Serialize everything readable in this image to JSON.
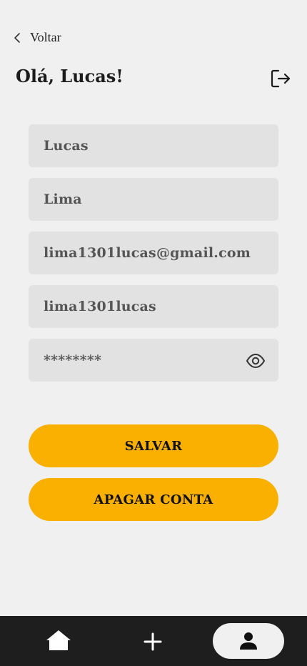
{
  "header": {
    "back_label": "Voltar",
    "greeting": "Olá, Lucas!"
  },
  "form": {
    "first_name": "Lucas",
    "last_name": "Lima",
    "email": "lima1301lucas@gmail.com",
    "username": "lima1301lucas",
    "password_masked": "********"
  },
  "buttons": {
    "save": "SALVAR",
    "delete_account": "APAGAR CONTA"
  },
  "icons": {
    "back": "chevron-left-icon",
    "logout": "logout-icon",
    "password_toggle": "eye-icon",
    "home": "home-icon",
    "add": "plus-icon",
    "profile": "user-icon"
  },
  "colors": {
    "accent": "#f9b000",
    "background": "#f0f0f0",
    "field": "#e2e2e2",
    "navbar": "#1e1e1e"
  },
  "navbar": {
    "active": "profile"
  }
}
